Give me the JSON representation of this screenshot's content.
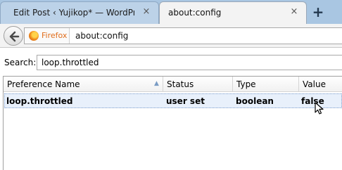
{
  "tabs": [
    {
      "title": "Edit Post ‹ Yujikop* — WordPre...",
      "active": false
    },
    {
      "title": "about:config",
      "active": true
    }
  ],
  "new_tab_label": "+",
  "close_glyph": "×",
  "nav": {
    "identity_label": "Firefox",
    "url": "about:config"
  },
  "search": {
    "label": "Search:",
    "value": "loop.throttled"
  },
  "table": {
    "columns": [
      "Preference Name",
      "Status",
      "Type",
      "Value"
    ],
    "rows": [
      {
        "name": "loop.throttled",
        "status": "user set",
        "type": "boolean",
        "value": "false"
      }
    ]
  },
  "icons": {
    "back": "back-arrow-icon",
    "identity": "firefox-icon",
    "sort": "sort-ascending-icon",
    "cursor": "mouse-pointer-icon"
  },
  "colors": {
    "tabstrip": "#a9c6e2",
    "identity_text": "#e06d1b",
    "selected_row": "#e8f0fb"
  }
}
